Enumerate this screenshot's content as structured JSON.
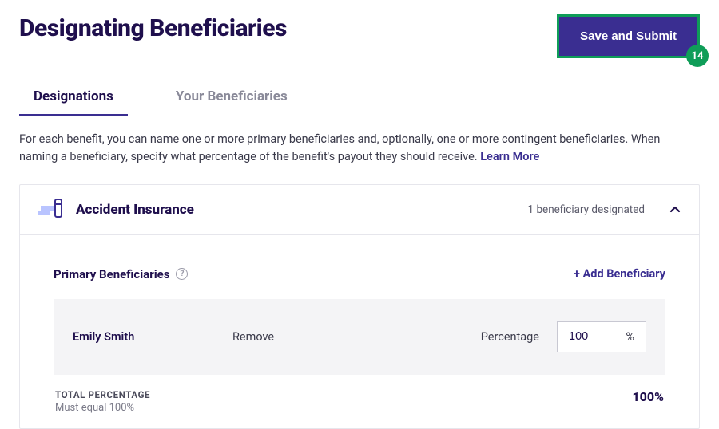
{
  "header": {
    "title": "Designating Beneficiaries",
    "save_label": "Save and Submit",
    "badge_count": "14"
  },
  "tabs": {
    "designations": "Designations",
    "your_beneficiaries": "Your Beneficiaries"
  },
  "intro": {
    "text": "For each benefit, you can name one or more primary beneficiaries and, optionally, one or more contingent beneficiaries. When naming a beneficiary, specify what percentage of the benefit's payout they should receive. ",
    "learn_more": "Learn More"
  },
  "panel": {
    "title": "Accident Insurance",
    "status": "1 beneficiary designated"
  },
  "primary": {
    "title": "Primary Beneficiaries",
    "add_label": "+ Add Beneficiary",
    "rows": [
      {
        "name": "Emily Smith",
        "remove": "Remove",
        "pct_label": "Percentage",
        "pct_value": "100",
        "pct_sign": "%"
      }
    ],
    "total_label": "TOTAL PERCENTAGE",
    "total_sub": "Must equal 100%",
    "total_value": "100%"
  }
}
